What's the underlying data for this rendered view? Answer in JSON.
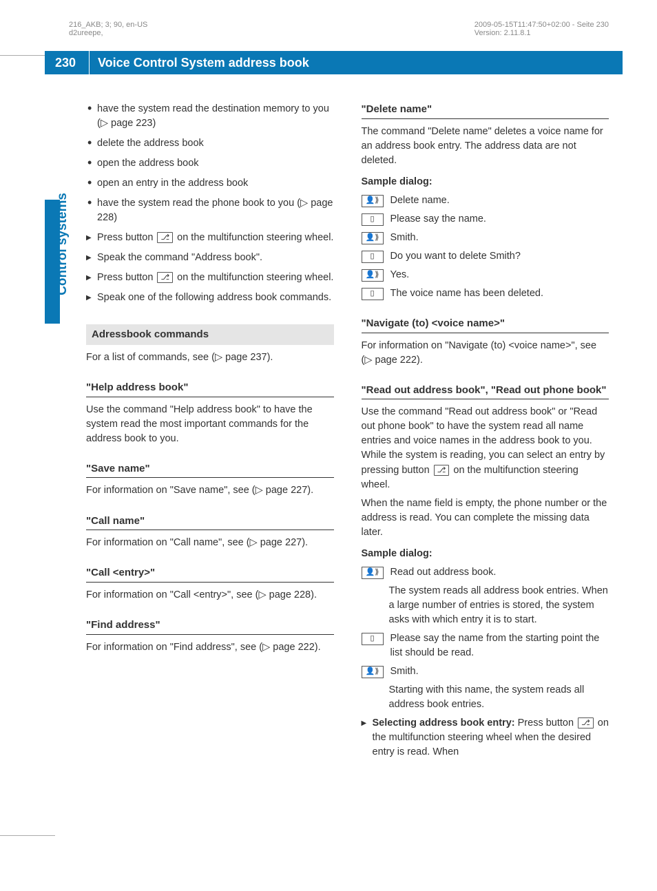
{
  "meta": {
    "left1": "216_AKB; 3; 90, en-US",
    "left2": "d2ureepe,",
    "right1": "2009-05-15T11:47:50+02:00 - Seite 230",
    "right2": "Version: 2.11.8.1"
  },
  "page_number": "230",
  "title": "Voice Control System address book",
  "side_label": "Control systems",
  "left_col": {
    "bullets": [
      "have the system read the destination memory to you (▷ page 223)",
      "delete the address book",
      "open the address book",
      "open an entry in the address book",
      "have the system read the phone book to you (▷ page 228)"
    ],
    "steps": [
      {
        "pre": "Press button ",
        "btn": "⎇",
        "post": " on the multifunction steering wheel."
      },
      {
        "pre": "Speak the command \"Address book\".",
        "btn": "",
        "post": ""
      },
      {
        "pre": "Press button ",
        "btn": "⎇",
        "post": " on the multifunction steering wheel."
      },
      {
        "pre": "Speak one of the following address book commands.",
        "btn": "",
        "post": ""
      }
    ],
    "section_bar": "Adressbook commands",
    "section_intro": "For a list of commands, see (▷ page 237).",
    "subs": [
      {
        "h": "\"Help address book\"",
        "p": "Use the command \"Help address book\" to have the system read the most important commands for the address book to you."
      },
      {
        "h": "\"Save name\"",
        "p": "For information on \"Save name\", see (▷ page 227)."
      },
      {
        "h": "\"Call name\"",
        "p": "For information on \"Call name\", see (▷ page 227)."
      },
      {
        "h": "\"Call <entry>\"",
        "p": "For information on \"Call <entry>\", see (▷ page 228)."
      },
      {
        "h": "\"Find address\"",
        "p": "For information on \"Find address\", see (▷ page 222)."
      }
    ]
  },
  "right_col": {
    "delete": {
      "h": "\"Delete name\"",
      "intro": "The command \"Delete name\" deletes a voice name for an address book entry. The address data are not deleted.",
      "dialog_label": "Sample dialog:",
      "dialog": [
        {
          "icon": "user",
          "t": "Delete name."
        },
        {
          "icon": "sys",
          "t": "Please say the name."
        },
        {
          "icon": "user",
          "t": "Smith."
        },
        {
          "icon": "sys",
          "t": "Do you want to delete Smith?"
        },
        {
          "icon": "user",
          "t": "Yes."
        },
        {
          "icon": "sys",
          "t": "The voice name has been deleted."
        }
      ]
    },
    "navigate": {
      "h": "\"Navigate (to) <voice name>\"",
      "p": "For information on \"Navigate (to) <voice name>\", see (▷ page 222)."
    },
    "readout": {
      "h": "\"Read out address book\", \"Read out phone book\"",
      "p1_pre": "Use the command \"Read out address book\" or \"Read out phone book\" to have the system read all name entries and voice names in the address book to you. While the system is reading, you can select an entry by pressing button ",
      "p1_btn": "⎇",
      "p1_post": " on the multifunction steering wheel.",
      "p2": "When the name field is empty, the phone number or the address is read. You can complete the missing data later.",
      "dialog_label": "Sample dialog:",
      "dialog": [
        {
          "icon": "user",
          "t": "Read out address book."
        },
        {
          "icon": "",
          "t": "The system reads all address book entries. When a large number of entries is stored, the system asks with which entry it is to start."
        },
        {
          "icon": "sys",
          "t": "Please say the name from the starting point the list should be read."
        },
        {
          "icon": "user",
          "t": "Smith."
        },
        {
          "icon": "",
          "t": "Starting with this name, the system reads all address book entries."
        }
      ],
      "select_step_bold": "Selecting address book entry: ",
      "select_step_pre": "Press button ",
      "select_step_btn": "⎇",
      "select_step_post": " on the multifunction steering wheel when the desired entry is read. When"
    }
  }
}
